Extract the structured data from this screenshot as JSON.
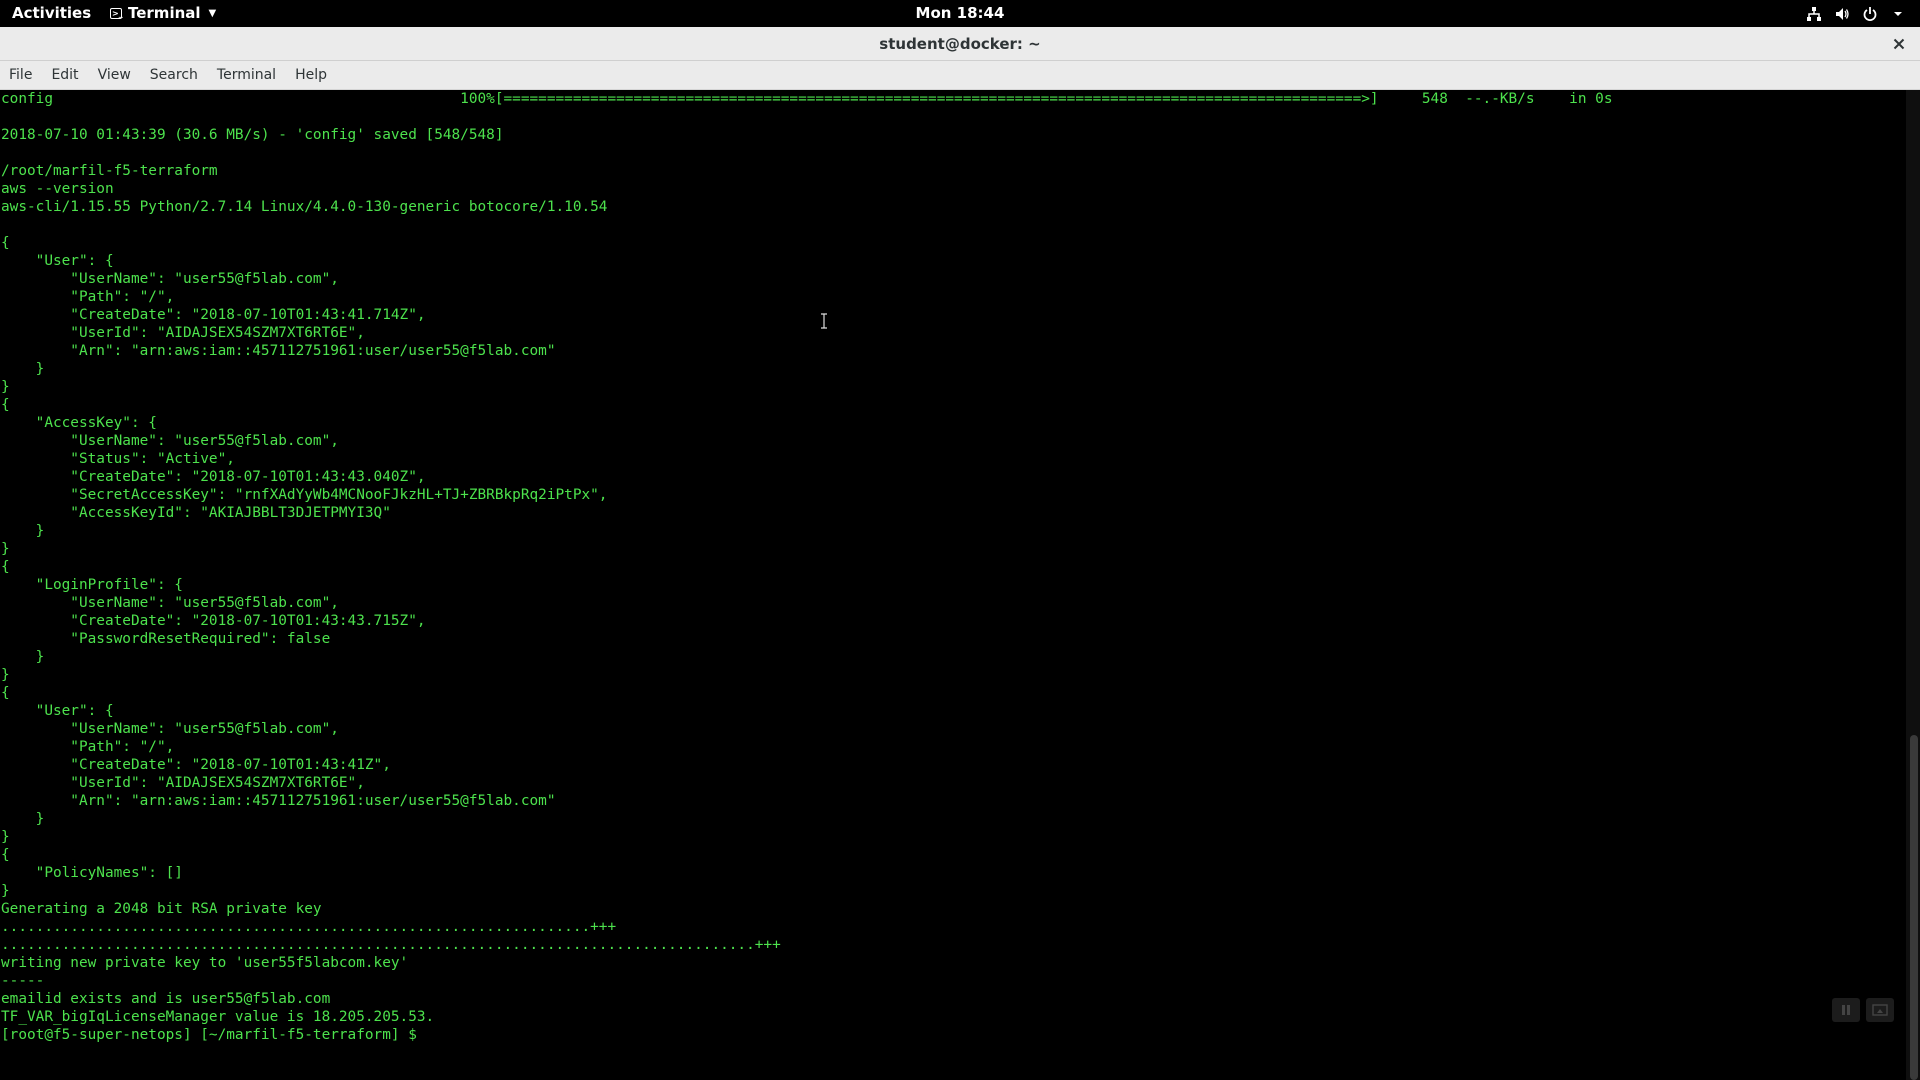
{
  "topbar": {
    "activities": "Activities",
    "app_name": "Terminal",
    "clock": "Mon 18:44"
  },
  "window": {
    "title": "student@docker: ~"
  },
  "menu": {
    "items": [
      "File",
      "Edit",
      "View",
      "Search",
      "Terminal",
      "Help"
    ]
  },
  "terminal": {
    "lines": [
      "config                                               100%[===================================================================================================>]     548  --.-KB/s    in 0s",
      "",
      "2018-07-10 01:43:39 (30.6 MB/s) - 'config' saved [548/548]",
      "",
      "/root/marfil-f5-terraform",
      "aws --version",
      "aws-cli/1.15.55 Python/2.7.14 Linux/4.4.0-130-generic botocore/1.10.54",
      "",
      "{",
      "    \"User\": {",
      "        \"UserName\": \"user55@f5lab.com\",",
      "        \"Path\": \"/\",",
      "        \"CreateDate\": \"2018-07-10T01:43:41.714Z\",",
      "        \"UserId\": \"AIDAJSEX54SZM7XT6RT6E\",",
      "        \"Arn\": \"arn:aws:iam::457112751961:user/user55@f5lab.com\"",
      "    }",
      "}",
      "{",
      "    \"AccessKey\": {",
      "        \"UserName\": \"user55@f5lab.com\",",
      "        \"Status\": \"Active\",",
      "        \"CreateDate\": \"2018-07-10T01:43:43.040Z\",",
      "        \"SecretAccessKey\": \"rnfXAdYyWb4MCNooFJkzHL+TJ+ZBRBkpRq2iPtPx\",",
      "        \"AccessKeyId\": \"AKIAJBBLT3DJETPMYI3Q\"",
      "    }",
      "}",
      "{",
      "    \"LoginProfile\": {",
      "        \"UserName\": \"user55@f5lab.com\",",
      "        \"CreateDate\": \"2018-07-10T01:43:43.715Z\",",
      "        \"PasswordResetRequired\": false",
      "    }",
      "}",
      "{",
      "    \"User\": {",
      "        \"UserName\": \"user55@f5lab.com\",",
      "        \"Path\": \"/\",",
      "        \"CreateDate\": \"2018-07-10T01:43:41Z\",",
      "        \"UserId\": \"AIDAJSEX54SZM7XT6RT6E\",",
      "        \"Arn\": \"arn:aws:iam::457112751961:user/user55@f5lab.com\"",
      "    }",
      "}",
      "{",
      "    \"PolicyNames\": []",
      "}",
      "Generating a 2048 bit RSA private key",
      "....................................................................+++",
      ".......................................................................................+++",
      "writing new private key to 'user55f5labcom.key'",
      "-----",
      "emailid exists and is user55@f5lab.com",
      "TF_VAR_bigIqLicenseManager value is 18.205.205.53.",
      "[root@f5-super-netops] [~/marfil-f5-terraform] $ "
    ]
  },
  "colors": {
    "terminal_fg": "#4de24d",
    "terminal_bg": "#000000",
    "titlebar_bg": "#ebebeb"
  },
  "icons": {
    "app": "terminal-icon",
    "tray": [
      "network-icon",
      "volume-icon",
      "power-icon",
      "chevron-down-icon"
    ],
    "close": "close-icon"
  }
}
